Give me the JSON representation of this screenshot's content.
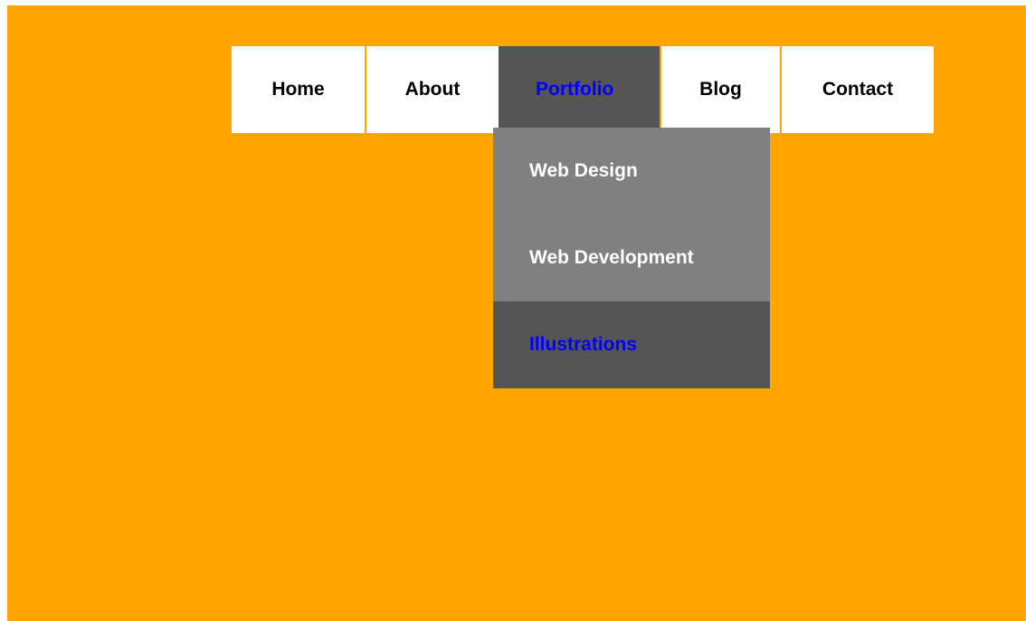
{
  "nav": {
    "items": [
      {
        "label": "Home"
      },
      {
        "label": "About"
      },
      {
        "label": "Portfolio"
      },
      {
        "label": "Blog"
      },
      {
        "label": "Contact"
      }
    ],
    "active_index": 2
  },
  "dropdown": {
    "items": [
      {
        "label": "Web Design"
      },
      {
        "label": "Web Development"
      },
      {
        "label": "Illustrations"
      }
    ],
    "active_index": 2
  },
  "colors": {
    "background": "#ffa500",
    "nav_bg": "#ffffff",
    "active_bg": "#555555",
    "dropdown_bg": "#808080",
    "active_text": "#0000ff"
  }
}
